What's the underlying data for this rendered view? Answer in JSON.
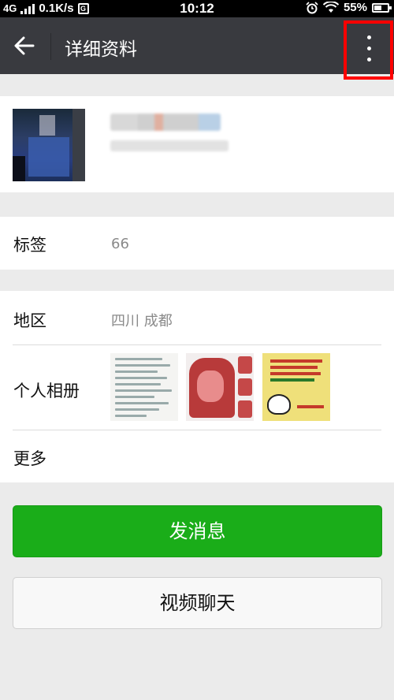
{
  "status_bar": {
    "network": "4G",
    "speed": "0.1K/s",
    "time": "10:12",
    "battery": "55%",
    "battery_level": 0.55
  },
  "header": {
    "title": "详细资料",
    "back_icon": "arrow-left-icon",
    "more_icon": "more-vertical-icon"
  },
  "profile": {
    "avatar": "blurred-avatar"
  },
  "tag_row": {
    "label": "标签",
    "value": "66"
  },
  "region_row": {
    "label": "地区",
    "value": "四川  成都"
  },
  "album_row": {
    "label": "个人相册"
  },
  "more_row": {
    "label": "更多"
  },
  "buttons": {
    "send_message": "发消息",
    "video_chat": "视频聊天"
  },
  "colors": {
    "titlebar": "#393a3f",
    "primary_green": "#1aad19",
    "highlight_red": "#ff0000",
    "background": "#ebebeb"
  }
}
